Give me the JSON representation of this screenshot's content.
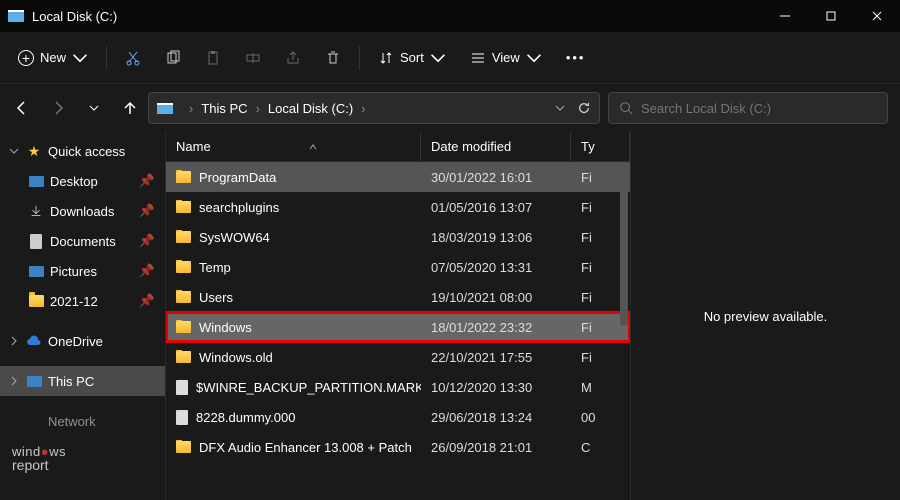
{
  "window": {
    "title": "Local Disk (C:)"
  },
  "toolbar": {
    "new_label": "New",
    "sort_label": "Sort",
    "view_label": "View"
  },
  "breadcrumb": {
    "root": "This PC",
    "current": "Local Disk (C:)"
  },
  "search": {
    "placeholder": "Search Local Disk (C:)"
  },
  "sidebar": {
    "quick_access": "Quick access",
    "items": [
      {
        "label": "Desktop",
        "pinned": true
      },
      {
        "label": "Downloads",
        "pinned": true
      },
      {
        "label": "Documents",
        "pinned": true
      },
      {
        "label": "Pictures",
        "pinned": true
      },
      {
        "label": "2021-12",
        "pinned": true
      }
    ],
    "onedrive": "OneDrive",
    "thispc": "This PC",
    "network": "Network"
  },
  "columns": {
    "name": "Name",
    "date": "Date modified",
    "type": "Ty"
  },
  "files": [
    {
      "name": "ProgramData",
      "date": "30/01/2022 16:01",
      "type": "Fi",
      "icon": "folder",
      "selected": true
    },
    {
      "name": "searchplugins",
      "date": "01/05/2016 13:07",
      "type": "Fi",
      "icon": "folder"
    },
    {
      "name": "SysWOW64",
      "date": "18/03/2019 13:06",
      "type": "Fi",
      "icon": "folder"
    },
    {
      "name": "Temp",
      "date": "07/05/2020 13:31",
      "type": "Fi",
      "icon": "folder"
    },
    {
      "name": "Users",
      "date": "19/10/2021 08:00",
      "type": "Fi",
      "icon": "folder"
    },
    {
      "name": "Windows",
      "date": "18/01/2022 23:32",
      "type": "Fi",
      "icon": "folder",
      "highlighted": true
    },
    {
      "name": "Windows.old",
      "date": "22/10/2021 17:55",
      "type": "Fi",
      "icon": "folder"
    },
    {
      "name": "$WINRE_BACKUP_PARTITION.MARKER",
      "date": "10/12/2020 13:30",
      "type": "M",
      "icon": "file"
    },
    {
      "name": "8228.dummy.000",
      "date": "29/06/2018 13:24",
      "type": "00",
      "icon": "file"
    },
    {
      "name": "DFX Audio Enhancer 13.008 + Patch",
      "date": "26/09/2018 21:01",
      "type": "C",
      "icon": "folder"
    }
  ],
  "preview": {
    "text": "No preview available."
  },
  "watermark": {
    "line1_a": "wind",
    "line1_b": "ws",
    "line2": "report"
  }
}
